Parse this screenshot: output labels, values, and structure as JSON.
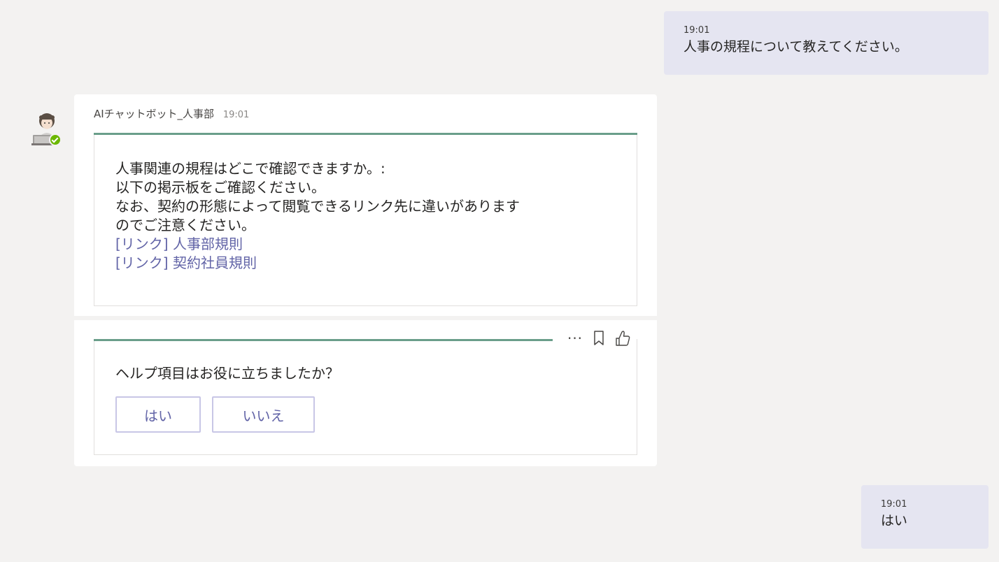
{
  "messages": {
    "outgoing_1": {
      "time": "19:01",
      "text": "人事の規程について教えてください。"
    },
    "outgoing_2": {
      "time": "19:01",
      "text": "はい"
    }
  },
  "bot": {
    "sender": "AIチャットボット_人事部",
    "time": "19:01",
    "answer_lines": [
      "人事関連の規程はどこで確認できますか。:",
      "以下の掲示板をご確認ください。",
      "なお、契約の形態によって閲覧できるリンク先に違いがあります",
      "のでご注意ください。"
    ],
    "links": [
      "[リンク] 人事部規則",
      "[リンク] 契約社員規則"
    ],
    "feedback": {
      "question": "ヘルプ項目はお役に立ちましたか？",
      "yes_label": "はい",
      "no_label": "いいえ"
    }
  },
  "icons": {
    "more": "more-options-icon",
    "bookmark": "bookmark-icon",
    "like": "thumbs-up-icon",
    "status": "available-status-icon"
  },
  "colors": {
    "background": "#f3f2f1",
    "outgoing_bubble": "#e5e5f1",
    "card_accent": "#6a9e8a",
    "link": "#6264a7",
    "status": "#6bb700"
  }
}
